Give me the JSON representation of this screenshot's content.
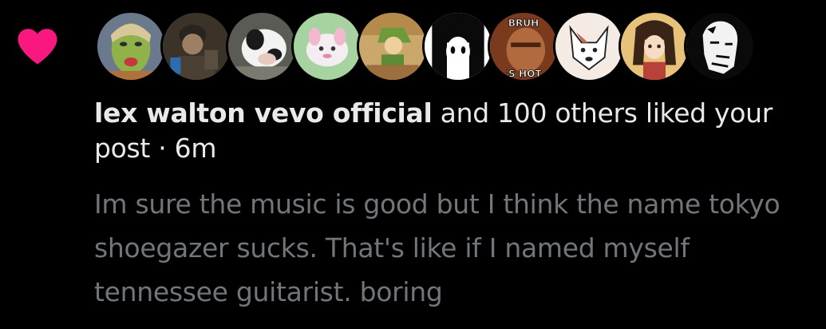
{
  "notification": {
    "type_icon": "heart-icon",
    "heart_color": "#f91880",
    "avatars": [
      {
        "name": "avatar-green-face",
        "icon": "avatar-image"
      },
      {
        "name": "avatar-person-photo",
        "icon": "avatar-image"
      },
      {
        "name": "avatar-cow",
        "icon": "avatar-image"
      },
      {
        "name": "avatar-pink-creature",
        "icon": "avatar-image"
      },
      {
        "name": "avatar-link-art",
        "icon": "avatar-image"
      },
      {
        "name": "avatar-anime-girl-bw",
        "icon": "avatar-image"
      },
      {
        "name": "avatar-bruh-meme",
        "icon": "avatar-image",
        "caption_top": "BRUH",
        "caption_bottom": "'S HOT"
      },
      {
        "name": "avatar-dog-sketch",
        "icon": "avatar-image"
      },
      {
        "name": "avatar-anime-girl-color",
        "icon": "avatar-image"
      },
      {
        "name": "avatar-bw-sketch",
        "icon": "avatar-image"
      }
    ],
    "actor_name": "lex walton vevo official",
    "action_text": " and 100 others liked your post",
    "separator": " · ",
    "time": "6m",
    "post_text": "Im sure the music is good but I think the name tokyo shoegazer sucks. That's like if I named myself tennessee guitarist. boring"
  },
  "colors": {
    "background": "#000000",
    "primary_text": "#e7e9ea",
    "secondary_text": "#71767b",
    "like_pink": "#f91880"
  }
}
